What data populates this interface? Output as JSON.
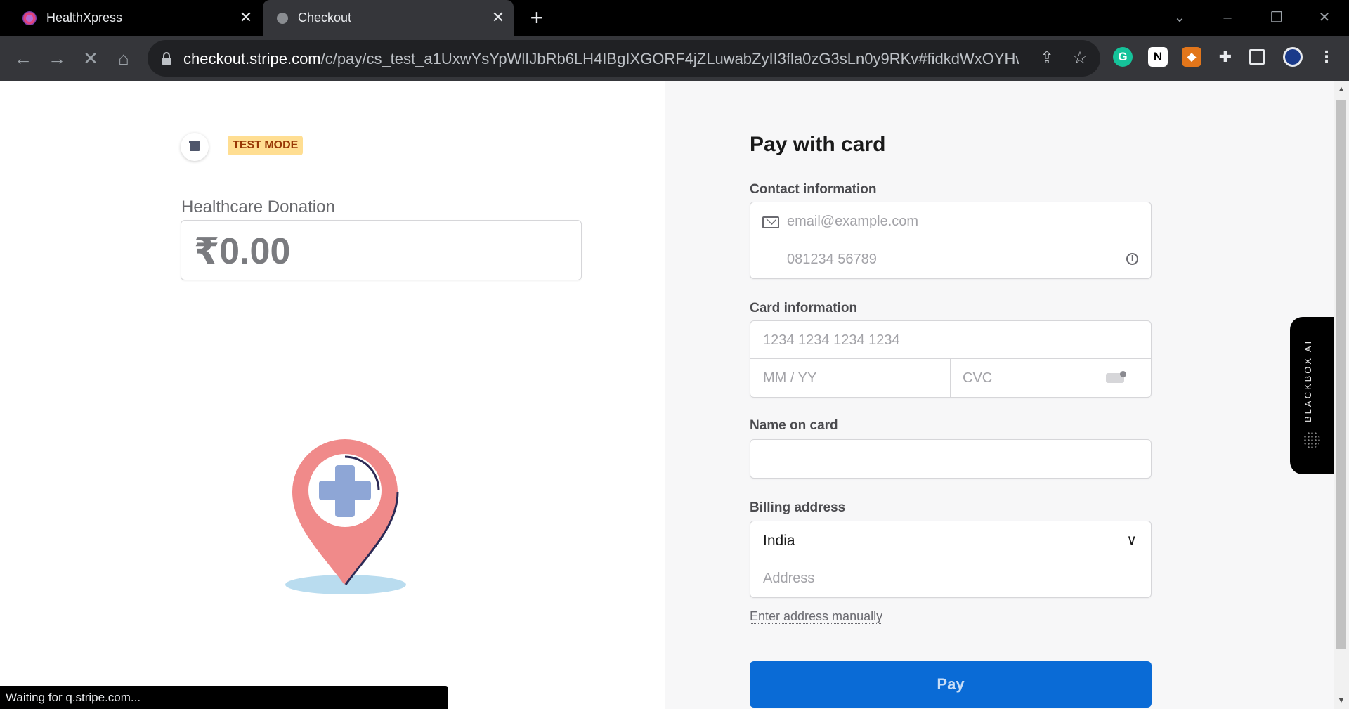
{
  "browser": {
    "tabs": [
      {
        "title": "HealthXpress"
      },
      {
        "title": "Checkout"
      }
    ],
    "url_host": "checkout.stripe.com",
    "url_path": "/c/pay/cs_test_a1UxwYsYpWlIJbRb6LH4IBgIXGORF4jZLuwabZyII3fla0zG3sLn0y9RKv#fidkdWxOYHwnPyd1blp...",
    "status_text": "Waiting for q.stripe.com..."
  },
  "merchant": {
    "badge": "TEST MODE",
    "product_name": "Healthcare Donation",
    "amount": "₹0.00"
  },
  "form": {
    "title": "Pay with card",
    "contact_label": "Contact information",
    "email_placeholder": "email@example.com",
    "phone_placeholder": "081234 56789",
    "card_label": "Card information",
    "card_number_placeholder": "1234 1234 1234 1234",
    "expiry_placeholder": "MM / YY",
    "cvc_placeholder": "CVC",
    "name_label": "Name on card",
    "billing_label": "Billing address",
    "country_value": "India",
    "address_placeholder": "Address",
    "manual_link": "Enter address manually",
    "pay_label": "Pay"
  },
  "extension_panel": {
    "label": "BLACKBOX AI"
  },
  "colors": {
    "accent": "#0a6bd6",
    "badge_bg": "#ffde92",
    "pin_red": "#f08a8a",
    "cross_blue": "#8ea6d6"
  }
}
